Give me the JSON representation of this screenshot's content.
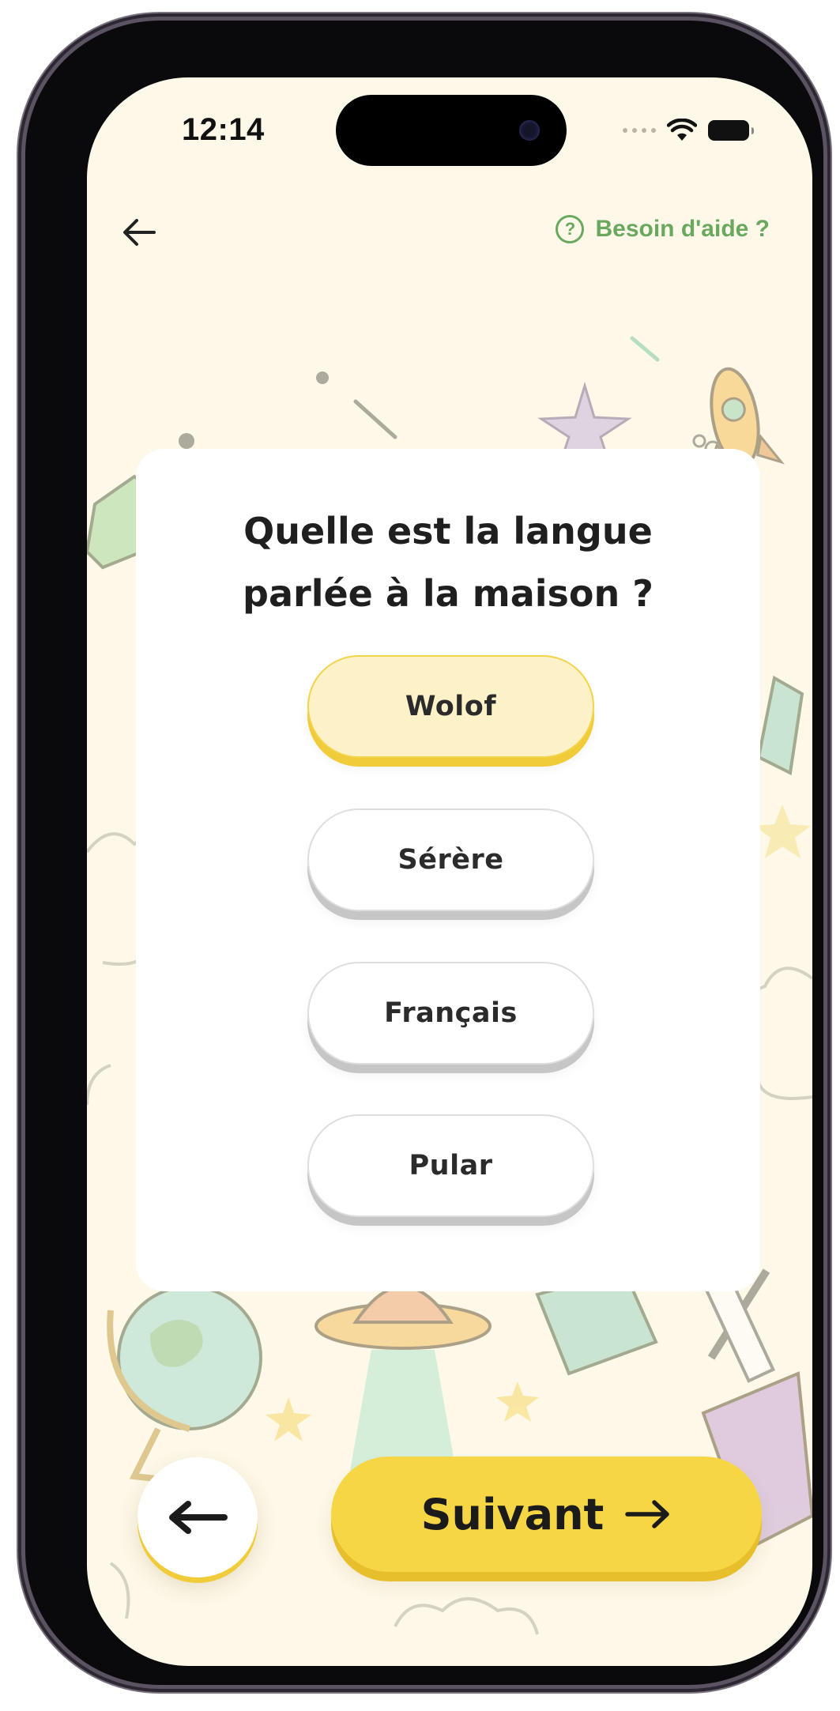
{
  "status_bar": {
    "time": "12:14"
  },
  "header": {
    "help_label": "Besoin d'aide ?"
  },
  "question": {
    "line1": "Quelle est la langue",
    "line2": "parlée à la maison ?"
  },
  "options": [
    {
      "label": "Wolof",
      "selected": true
    },
    {
      "label": "Sérère",
      "selected": false
    },
    {
      "label": "Français",
      "selected": false
    },
    {
      "label": "Pular",
      "selected": false
    }
  ],
  "footer": {
    "next_label": "Suivant"
  },
  "colors": {
    "background": "#fdf8e7",
    "accent_yellow": "#f7d646",
    "selected_option": "#fdf2c7",
    "help_green": "#6aa860",
    "text_dark": "#1f1f1f"
  },
  "icons": {
    "back": "arrow-left-icon",
    "help": "question-circle-icon",
    "prev": "arrow-left-icon",
    "next": "arrow-right-icon",
    "wifi": "wifi-icon",
    "battery": "battery-icon"
  }
}
